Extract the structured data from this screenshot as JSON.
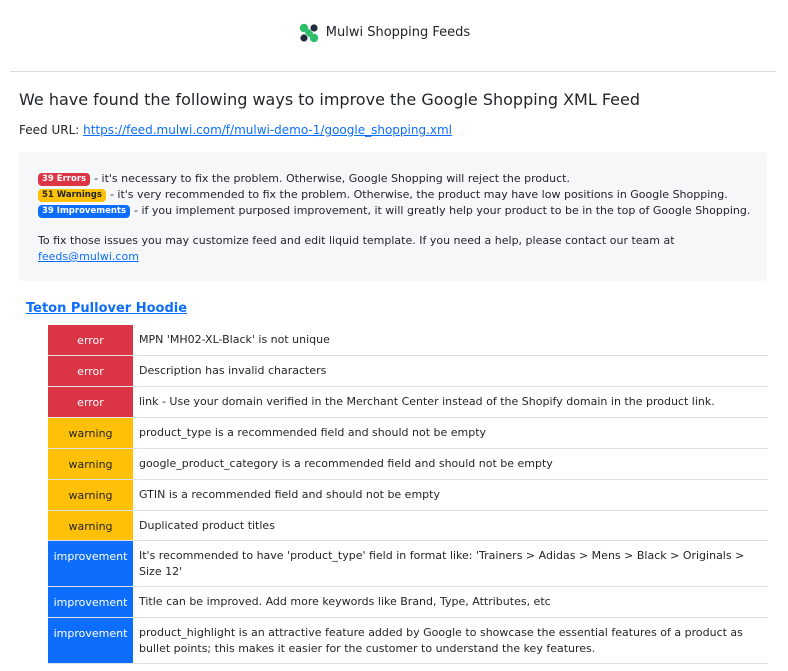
{
  "header": {
    "brand": "Mulwi Shopping Feeds"
  },
  "title": "We have found the following ways to improve the Google Shopping XML Feed",
  "feed": {
    "label": "Feed URL: ",
    "url": "https://feed.mulwi.com/f/mulwi-demo-1/google_shopping.xml"
  },
  "summary": {
    "errors_badge": "39 Errors",
    "errors_text": " - it's necessary to fix the problem. Otherwise, Google Shopping will reject the product.",
    "warnings_badge": "51 Warnings",
    "warnings_text": " - it's very recommended to fix the problem. Otherwise, the product may have low positions in Google Shopping.",
    "improvements_badge": "39 Improvements",
    "improvements_text": " - if you implement purposed improvement, it will greatly help your product to be in the top of Google Shopping.",
    "help_text": "To fix those issues you may customize feed and edit liquid template. If you need a help, please contact our team at ",
    "help_email": "feeds@mulwi.com"
  },
  "product": {
    "name": "Teton Pullover Hoodie",
    "issues": [
      {
        "type": "error",
        "message": "MPN 'MH02-XL-Black' is not unique"
      },
      {
        "type": "error",
        "message": "Description has invalid characters"
      },
      {
        "type": "error",
        "message": "link - Use your domain verified in the Merchant Center instead of the Shopify domain in the product link."
      },
      {
        "type": "warning",
        "message": "product_type is a recommended field and should not be empty"
      },
      {
        "type": "warning",
        "message": "google_product_category is a recommended field and should not be empty"
      },
      {
        "type": "warning",
        "message": "GTIN is a recommended field and should not be empty"
      },
      {
        "type": "warning",
        "message": "Duplicated product titles"
      },
      {
        "type": "improvement",
        "message": "It's recommended to have 'product_type' field in format like: 'Trainers > Adidas > Mens > Black > Originals > Size 12'"
      },
      {
        "type": "improvement",
        "message": "Title can be improved. Add more keywords like Brand, Type, Attributes, etc"
      },
      {
        "type": "improvement",
        "message": "product_highlight is an attractive feature added by Google to showcase the essential features of a product as bullet points; this makes it easier for the customer to understand the key features."
      }
    ]
  },
  "colors": {
    "error": "#dc3545",
    "warning": "#ffc107",
    "improvement": "#0d6efd",
    "logo_green": "#2bbf6a",
    "logo_dark": "#1f2d3d"
  },
  "icons": {
    "logo": "mulwi-logo-icon"
  }
}
